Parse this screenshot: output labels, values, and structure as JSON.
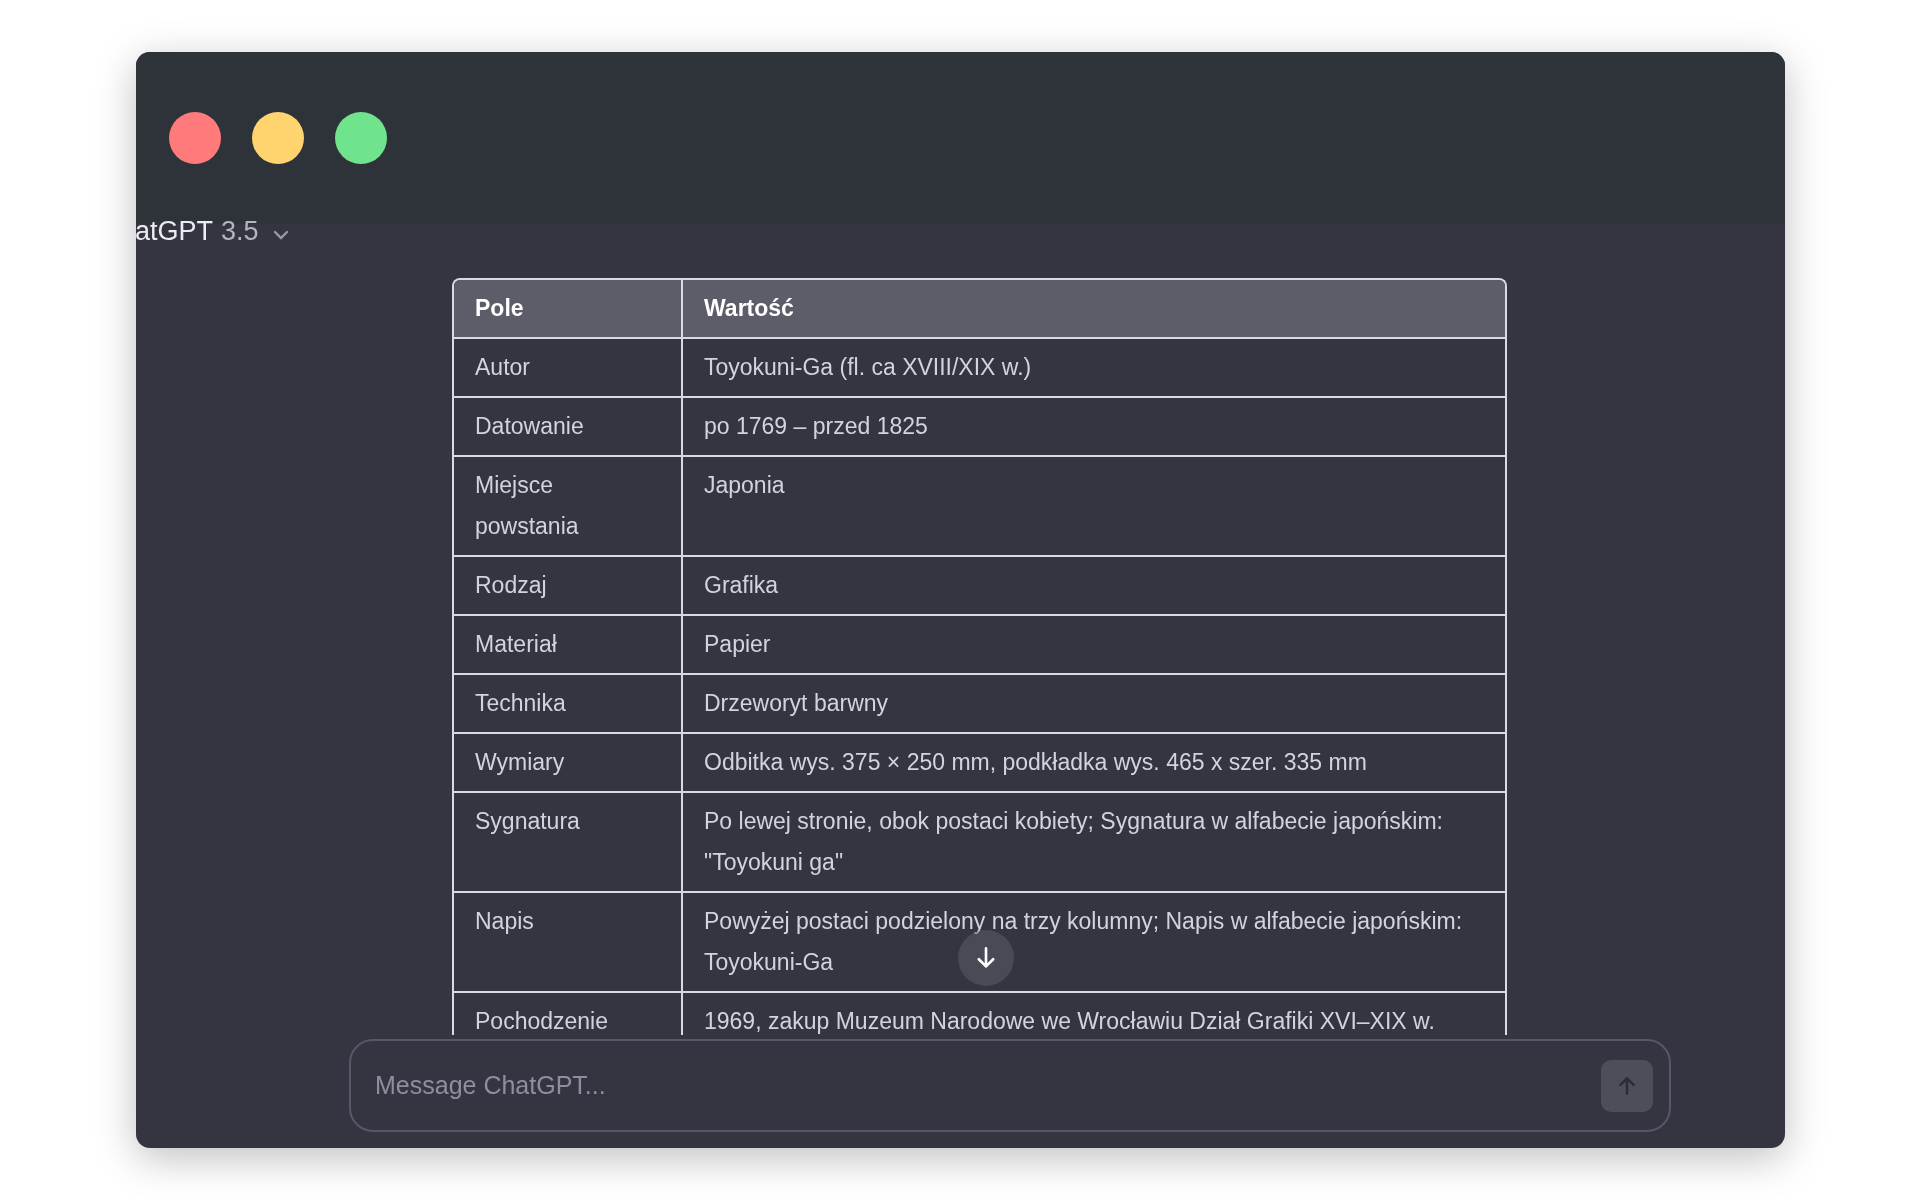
{
  "window": {
    "traffic_lights": [
      {
        "color": "#ff7b7b"
      },
      {
        "color": "#ffd36e"
      },
      {
        "color": "#6fe48d"
      }
    ]
  },
  "model_selector": {
    "name": "atGPT",
    "version": "3.5"
  },
  "table": {
    "columns": [
      "Pole",
      "Wartość"
    ],
    "rows": [
      {
        "field": "Autor",
        "value": "Toyokuni-Ga (fl. ca XVIII/XIX w.)"
      },
      {
        "field": "Datowanie",
        "value": "po 1769 – przed 1825"
      },
      {
        "field": "Miejsce powstania",
        "value": "Japonia"
      },
      {
        "field": "Rodzaj",
        "value": "Grafika"
      },
      {
        "field": "Materiał",
        "value": "Papier"
      },
      {
        "field": "Technika",
        "value": "Drzeworyt barwny"
      },
      {
        "field": "Wymiary",
        "value": "Odbitka wys. 375 × 250 mm, podkładka wys. 465 x szer. 335 mm"
      },
      {
        "field": "Sygnatura",
        "value": "Po lewej stronie, obok postaci kobiety; Sygnatura w alfabecie japońskim: \"Toyokuni ga\""
      },
      {
        "field": "Napis",
        "value": "Powyżej postaci podzielony na trzy kolumny; Napis w alfabecie japońskim: Toyokuni-Ga"
      },
      {
        "field": "Pochodzenie",
        "value": "1969, zakup Muzeum Narodowe we Wrocławiu Dział Grafiki XVI–XIX w."
      }
    ]
  },
  "composer": {
    "placeholder": "Message ChatGPT..."
  }
}
